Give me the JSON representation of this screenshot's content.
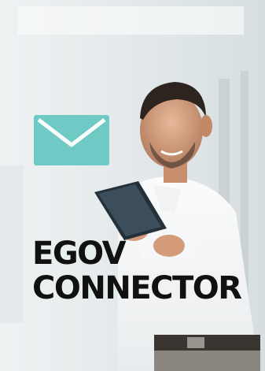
{
  "title": {
    "line1": "EGOV",
    "line2": "CONNECTOR"
  },
  "icons": {
    "envelope": "envelope-icon"
  },
  "colors": {
    "envelope_fill": "#6fcac6",
    "title_text": "#111111"
  }
}
